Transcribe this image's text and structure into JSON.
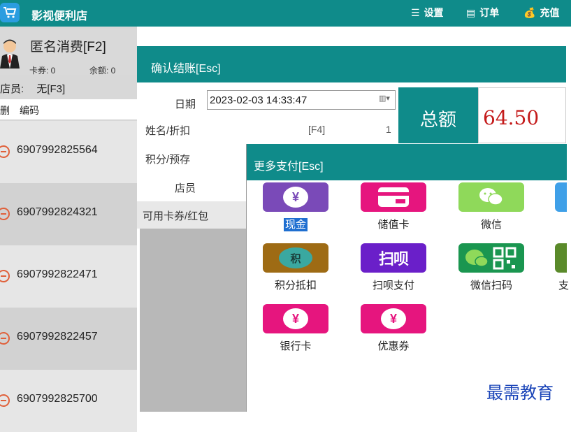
{
  "app": {
    "title": "影视便利店"
  },
  "top_menu": [
    {
      "label": "设置",
      "icon": "menu-icon"
    },
    {
      "label": "订单",
      "icon": "order-icon"
    },
    {
      "label": "充值",
      "icon": "money-bag-icon"
    }
  ],
  "member": {
    "name": "匿名消费[F2]",
    "coupon_label": "卡券: 0",
    "balance_label": "余额: 0"
  },
  "clerk": {
    "label": "店员:",
    "value": "无[F3]"
  },
  "list_header": {
    "delete": "删",
    "code": "编码"
  },
  "items": [
    {
      "code": "6907992825564"
    },
    {
      "code": "6907992824321"
    },
    {
      "code": "6907992822471"
    },
    {
      "code": "6907992822457"
    },
    {
      "code": "6907992825700"
    }
  ],
  "checkout": {
    "title": "确认结账[Esc]",
    "date_label": "日期",
    "date_value": "2023-02-03 14:33:47",
    "name_label": "姓名/折扣",
    "name_key": "[F4]",
    "name_value": "1",
    "points_label": "积分/预存",
    "clerk_label": "店员",
    "coupon_label": "可用卡券/红包",
    "total_label": "总额",
    "total_value": "64.50"
  },
  "more_pay": {
    "title": "更多支付[Esc]",
    "methods": [
      {
        "label": "现金",
        "color": "#7a4ab8",
        "icon": "yen-icon",
        "selected": true
      },
      {
        "label": "储值卡",
        "color": "#e6157e",
        "icon": "card-icon"
      },
      {
        "label": "微信",
        "color": "#8fd95a",
        "icon": "wechat-icon"
      },
      {
        "label": "积分抵扣",
        "color": "#9e6b14",
        "icon": "points-icon"
      },
      {
        "label": "扫呗支付",
        "color": "#6a1fc9",
        "icon": "saobei-icon"
      },
      {
        "label": "微信扫码",
        "color": "#1a9650",
        "icon": "wechat-qr-icon"
      },
      {
        "label": "银行卡",
        "color": "#e6157e",
        "icon": "yen-icon"
      },
      {
        "label": "优惠券",
        "color": "#e6157e",
        "icon": "yen-icon"
      }
    ],
    "partial": [
      {
        "label": "支",
        "color": "#3fa0e8"
      }
    ],
    "partial_top_color": "#3fa0e8",
    "partial_mid_color": "#5a8a2a"
  },
  "watermark": "最需教育"
}
